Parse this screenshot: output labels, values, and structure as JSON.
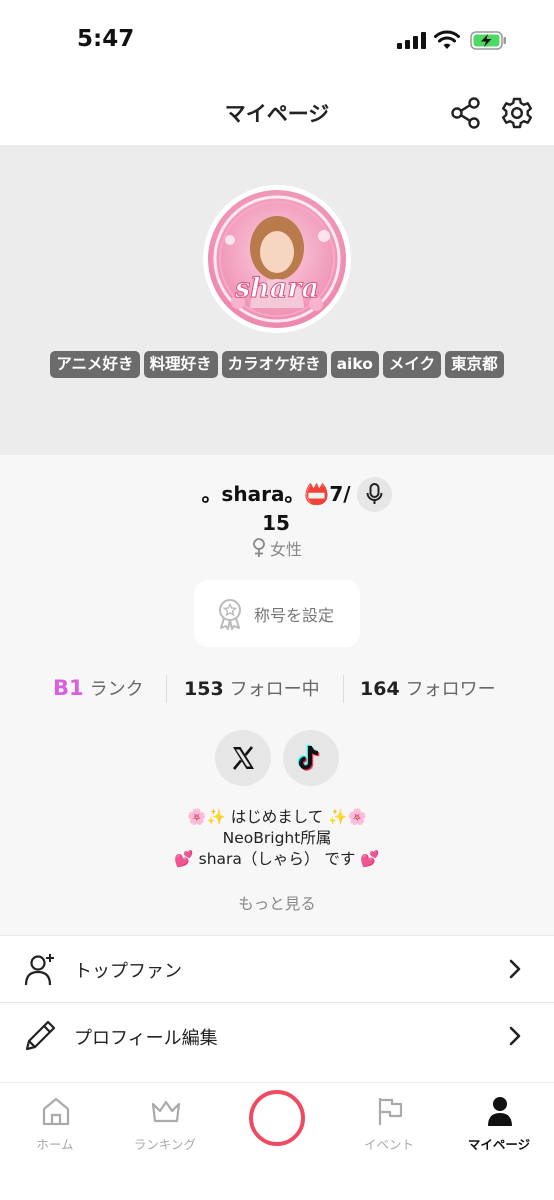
{
  "status_bar": {
    "time": "5:47"
  },
  "header": {
    "title": "マイページ",
    "share_icon": "share-icon",
    "settings_icon": "gear-icon"
  },
  "profile": {
    "avatar_text": "shara",
    "tags": [
      "アニメ好き",
      "料理好き",
      "カラオケ好き",
      "aiko",
      "メイク",
      "東京都"
    ],
    "username": "。shara。📛7/15",
    "gender": "女性",
    "title_button": "称号を設定",
    "stats": {
      "rank_value": "B1",
      "rank_label": "ランク",
      "following_count": "153",
      "following_label": "フォロー中",
      "followers_count": "164",
      "followers_label": "フォロワー"
    },
    "social": [
      "x-icon",
      "tiktok-icon"
    ],
    "bio": [
      "🌸✨ はじめまして ✨🌸",
      "NeoBright所属",
      "💕 shara（しゃら） です 💕"
    ],
    "more": "もっと見る"
  },
  "menu": [
    {
      "label": "トップファン",
      "icon": "user-plus-icon"
    },
    {
      "label": "プロフィール編集",
      "icon": "pencil-icon"
    }
  ],
  "tabbar": {
    "home": "ホーム",
    "ranking": "ランキング",
    "event": "イベント",
    "mypage": "マイページ"
  },
  "colors": {
    "accent": "#d860e0",
    "record": "#f04a63",
    "battery": "#4cd964"
  }
}
